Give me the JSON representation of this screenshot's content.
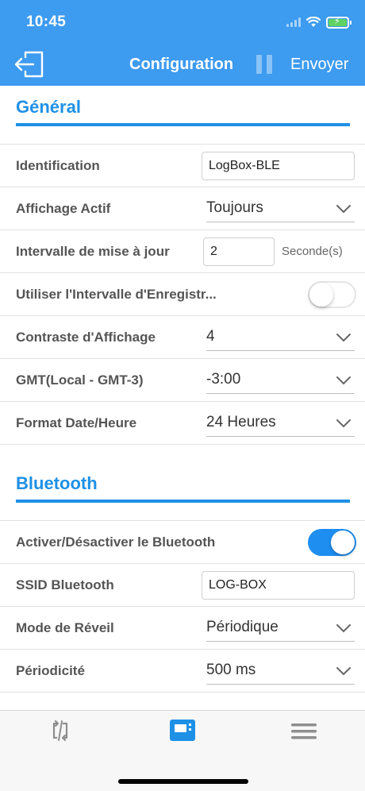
{
  "status": {
    "time": "10:45"
  },
  "nav": {
    "title": "Configuration",
    "send_label": "Envoyer"
  },
  "general": {
    "title": "Général",
    "identification": {
      "label": "Identification",
      "value": "LogBox-BLE"
    },
    "affichage": {
      "label": "Affichage Actif",
      "value": "Toujours"
    },
    "intervalle": {
      "label": "Intervalle de mise à jour",
      "value": "2",
      "unit": "Seconde(s)"
    },
    "utiliser": {
      "label": "Utiliser l'Intervalle d'Enregistr...",
      "enabled": false
    },
    "contraste": {
      "label": "Contraste d'Affichage",
      "value": "4"
    },
    "gmt": {
      "label": "GMT(Local - GMT-3)",
      "value": "-3:00"
    },
    "format": {
      "label": "Format Date/Heure",
      "value": "24 Heures"
    }
  },
  "bluetooth": {
    "title": "Bluetooth",
    "activer": {
      "label": "Activer/Désactiver le Bluetooth",
      "enabled": true
    },
    "ssid": {
      "label": "SSID Bluetooth",
      "value": "LOG-BOX"
    },
    "mode": {
      "label": "Mode de Réveil",
      "value": "Périodique"
    },
    "periodicite": {
      "label": "Périodicité",
      "value": "500 ms"
    }
  },
  "colors": {
    "header": "#3d9bf0",
    "accent": "#1e90e6",
    "toggle_on": "#1e8ff0"
  },
  "tabs": [
    {
      "icon": "sync-icon",
      "active": false
    },
    {
      "icon": "device-icon",
      "active": true
    },
    {
      "icon": "menu-icon",
      "active": false
    }
  ]
}
